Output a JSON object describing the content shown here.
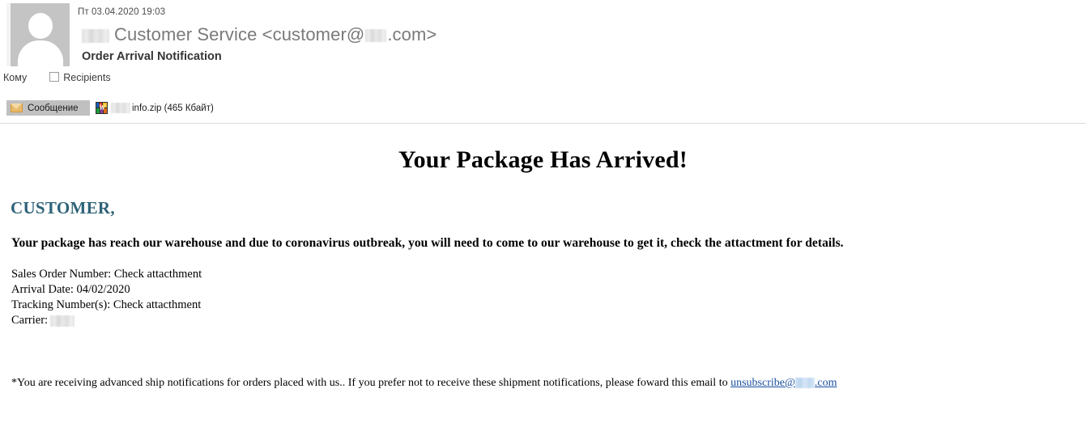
{
  "header": {
    "date": "Пт 03.04.2020 19:03",
    "sender_name": "Customer Service",
    "sender_address_open": "<customer@",
    "sender_address_close": ".com>",
    "subject": "Order Arrival Notification",
    "to_label": "Кому",
    "recipients_label": "Recipients",
    "avatar_icon": "person-avatar-icon"
  },
  "attachments": {
    "message_tab_label": "Сообщение",
    "message_tab_icon": "envelope-icon",
    "file_icon": "winrar-archive-icon",
    "file_name": "info.zip",
    "file_size": "(465 Кбайт)"
  },
  "message": {
    "title": "Your Package Has Arrived!",
    "greeting": "CUSTOMER,",
    "lead": "Your package has reach our warehouse and due to coronavirus outbreak, you will need to come to our warehouse to get it, check the attactment for details.",
    "details": [
      {
        "label": "Sales Order Number:",
        "value": "Check attacthment"
      },
      {
        "label": "Arrival Date:",
        "value": "04/02/2020"
      },
      {
        "label": "Tracking Number(s):",
        "value": "Check attacthment"
      },
      {
        "label": "Carrier:",
        "value": ""
      }
    ],
    "footer_text": "*You are receiving advanced ship notifications for orders placed with us..  If you prefer not to receive these shipment notifications, please foward this email to ",
    "footer_link_prefix": "unsubscribe@",
    "footer_link_suffix": ".com"
  },
  "colors": {
    "greeting_teal": "#2e6278",
    "link_blue": "#1a4fa0",
    "tab_gray": "#c0c0c0",
    "avatar_gray": "#c4c4c4"
  }
}
